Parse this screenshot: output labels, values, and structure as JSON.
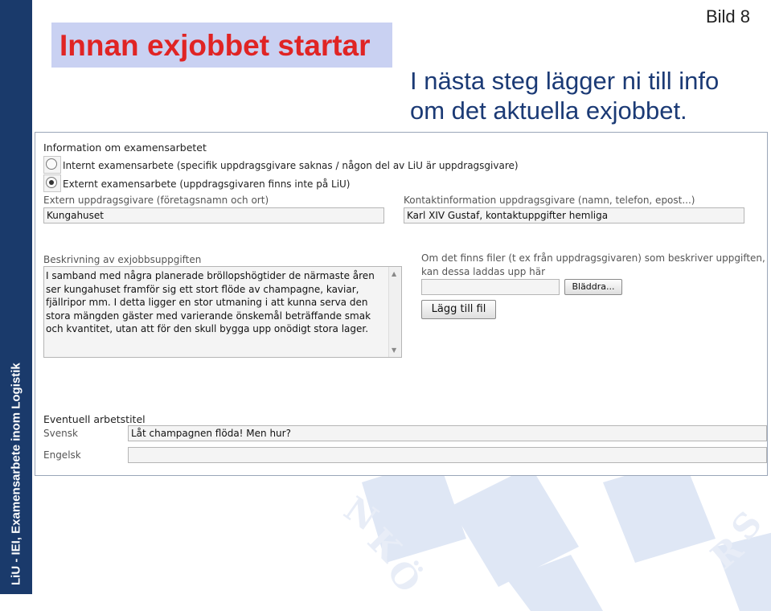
{
  "sidebar": {
    "text": "LiU - IEI, Examensarbete inom Logistik"
  },
  "slide": {
    "number": "Bild 8",
    "title": "Innan exjobbet startar",
    "subtitle_line1": "I nästa steg lägger ni till info",
    "subtitle_line2": "om det aktuella exjobbet."
  },
  "form": {
    "section_heading": "Information om examensarbetet",
    "radio_internal_label": "Internt examensarbete (specifik uppdragsgivare saknas / någon del av LiU är uppdragsgivare)",
    "radio_external_label": "Externt examensarbete (uppdragsgivaren finns inte på LiU)",
    "selected": "external",
    "client_label": "Extern uppdragsgivare (företagsnamn och ort)",
    "client_value": "Kungahuset",
    "contact_label": "Kontaktinformation uppdragsgivare (namn, telefon, epost...)",
    "contact_value": "Karl XIV Gustaf, kontaktuppgifter hemliga",
    "description_label": "Beskrivning av exjobbsuppgiften",
    "description_value": "I samband med några planerade bröllopshögtider de närmaste åren ser kungahuset framför sig ett stort flöde av champagne, kaviar, fjällripor mm. I detta ligger en stor utmaning i att kunna serva den stora mängden gäster med varierande önskemål beträffande smak och kvantitet, utan att för den skull bygga upp onödigt stora lager.",
    "files_label_line1": "Om det finns filer (t ex från uppdragsgivaren) som beskriver uppgiften,",
    "files_label_line2": "kan dessa laddas upp här",
    "browse_label": "Bläddra...",
    "add_file_label": "Lägg till fil",
    "title_heading": "Eventuell arbetstitel",
    "swedish_label": "Svensk",
    "swedish_value": "Låt champagnen flöda! Men hur?",
    "english_label": "Engelsk",
    "english_value": ""
  },
  "colors": {
    "sidebar": "#1a3a6b",
    "title_bg": "#c9d1f2",
    "title_text": "#e02424",
    "subtitle_text": "#1b3a75"
  }
}
